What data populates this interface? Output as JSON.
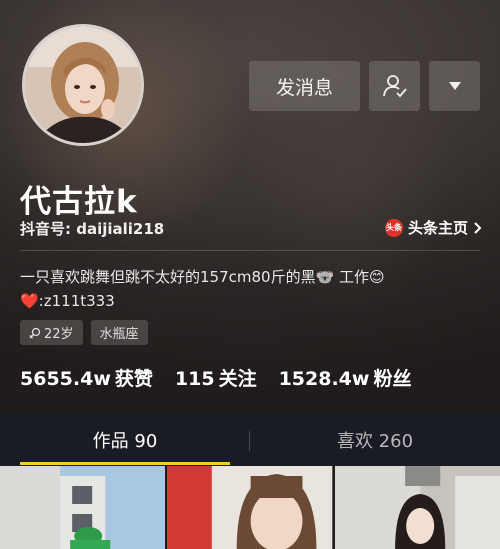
{
  "profile": {
    "name": "代古拉k",
    "douyin_id": "抖音号: daijiali218",
    "toutiao_label": "头条主页",
    "toutiao_logo": "头条",
    "bio_line1": "一只喜欢跳舞但跳不太好的157cm80斤的黑🐨 工作😊",
    "bio_line2": "❤️:z111t333",
    "tags": [
      "22岁",
      "水瓶座"
    ],
    "avatar_icon": "avatar"
  },
  "actions": {
    "message_label": "发消息",
    "follow_icon": "user-check-icon",
    "more_icon": "caret-down-icon"
  },
  "stats": [
    {
      "value": "5655.4w",
      "label": "获赞"
    },
    {
      "value": "115",
      "label": "关注"
    },
    {
      "value": "1528.4w",
      "label": "粉丝"
    }
  ],
  "tabs": [
    {
      "label": "作品 90"
    },
    {
      "label": "喜欢 260"
    }
  ],
  "colors": {
    "accent": "#f8cc2c",
    "tab_bg": "#1a1c24",
    "toutiao_red": "#e2322d"
  }
}
